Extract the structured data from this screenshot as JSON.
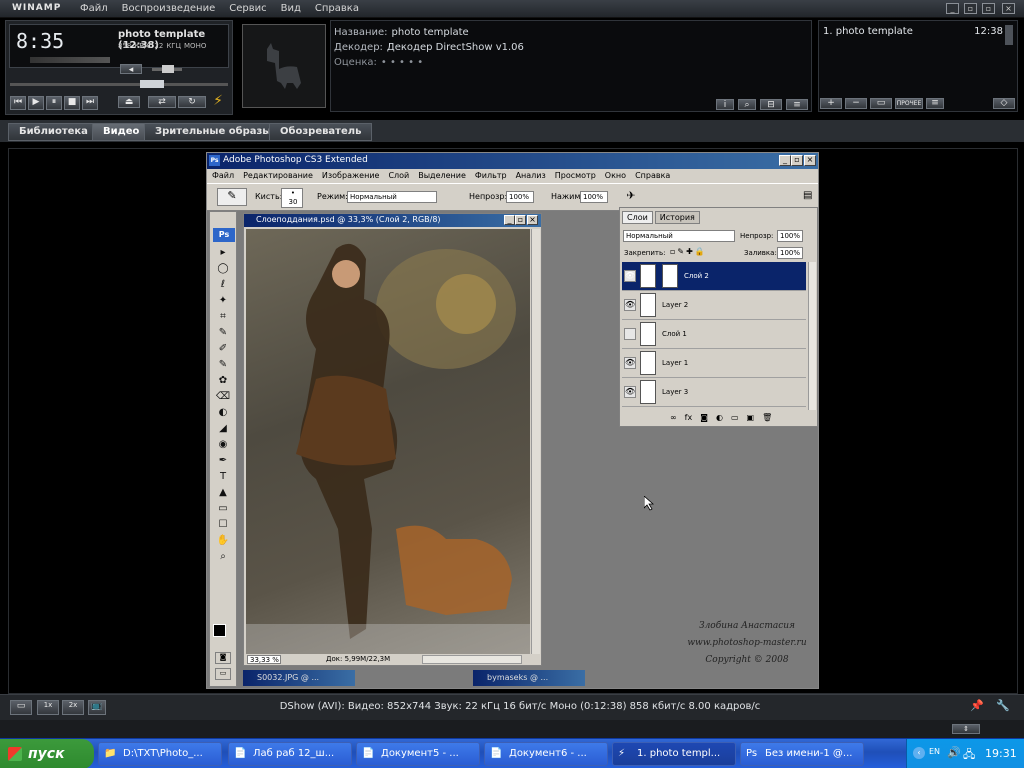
{
  "winamp": {
    "logo": "WINAMP",
    "menu": [
      "Файл",
      "Воспроизведение",
      "Сервис",
      "Вид",
      "Справка"
    ],
    "time": "8:35",
    "track": "photo template (12:38)",
    "bitrate": "858",
    "bitrate_unit": "КБ/С",
    "khz": "22",
    "khz_unit": "КГЦ",
    "mode": "МОНО",
    "info": {
      "name_label": "Название:",
      "name_value": "photo template",
      "decoder_label": "Декодер:",
      "decoder_value": "Декодер DirectShow v1.06",
      "rating_label": "Оценка:",
      "rating_value": "• • • • •"
    },
    "playlist": [
      {
        "title": "1. photo template",
        "time": "12:38"
      }
    ],
    "playlist_btns": [
      "+",
      "−",
      "▭",
      "ПРОЧЕЕ",
      "≡"
    ],
    "tabs": [
      "Библиотека",
      "Видео",
      "Зрительные образы",
      "Обозреватель"
    ],
    "active_tab": "Видео",
    "status": "DShow (AVI): Видео: 852x744 Звук: 22 кГц 16 бит/с Моно (0:12:38) 858 кбит/с 8.00 кадров/с",
    "zoom_labels": [
      "1x",
      "2x"
    ]
  },
  "photoshop": {
    "title": "Adobe Photoshop CS3 Extended",
    "menu": [
      "Файл",
      "Редактирование",
      "Изображение",
      "Слой",
      "Выделение",
      "Фильтр",
      "Анализ",
      "Просмотр",
      "Окно",
      "Справка"
    ],
    "opts": {
      "brush_label": "Кисть:",
      "brush_size": "30",
      "mode_label": "Режим:",
      "mode_value": "Нормальный",
      "opacity_label": "Непрозр:",
      "opacity_value": "100%",
      "press_label": "Нажим:",
      "press_value": "100%"
    },
    "doc_title": "Слоеподдания.psd @ 33,3% (Слой 2, RGB/8)",
    "doc_zoom": "33,33 %",
    "doc_info": "Док: 5,99M/22,3M",
    "minimized": [
      "S0032.JPG @ ...",
      "bymaseks @ ..."
    ],
    "layers_tabs": [
      "Слои",
      "История"
    ],
    "layers_mode": "Нормальный",
    "layers_opacity_label": "Непрозр:",
    "layers_opacity": "100%",
    "lock_label": "Закрепить:",
    "fill_label": "Заливка:",
    "fill_value": "100%",
    "layers": [
      {
        "name": "Слой 2",
        "visible": true,
        "selected": true
      },
      {
        "name": "Layer 2",
        "visible": true,
        "selected": false
      },
      {
        "name": "Слой 1",
        "visible": false,
        "selected": false
      },
      {
        "name": "Layer 1",
        "visible": true,
        "selected": false
      },
      {
        "name": "Layer 3",
        "visible": true,
        "selected": false
      }
    ],
    "ps_badge": "Ps",
    "tools": [
      "▸",
      "◯",
      "ℓ",
      "✦",
      "⌗",
      "✎",
      "✐",
      "✎",
      "✿",
      "⌫",
      "◐",
      "◢",
      "◉",
      "✒",
      "T",
      "▲",
      "▭",
      "☐",
      "✋",
      "⌕"
    ],
    "signature": [
      "Злобина Анастасия",
      "www.photoshop-master.ru",
      "Copyright © 2008"
    ]
  },
  "taskbar": {
    "start": "пуск",
    "tasks": [
      "D:\\TXT\\Photo_...",
      "Лаб раб 12_ш...",
      "Документ5 - ...",
      "Документ6 - ...",
      "1. photo templ...",
      "Без имени-1 @..."
    ],
    "active_task": 4,
    "clock": "19:31",
    "lang": "EN"
  }
}
